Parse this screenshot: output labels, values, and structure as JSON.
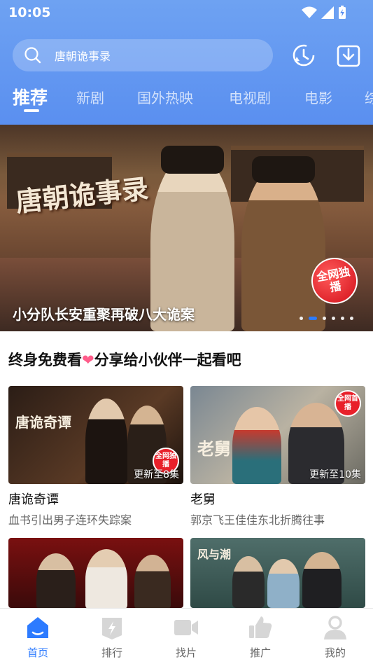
{
  "status": {
    "time": "10:05"
  },
  "search": {
    "text": "唐朝诡事录"
  },
  "tabs": [
    {
      "label": "推荐",
      "active": true
    },
    {
      "label": "新剧"
    },
    {
      "label": "国外热映"
    },
    {
      "label": "电视剧"
    },
    {
      "label": "电影"
    },
    {
      "label": "综"
    }
  ],
  "banner": {
    "logo_text": "唐朝诡事录",
    "badge": "全网独播",
    "caption": "小分队长安重聚再破八大诡案",
    "dot_count": 6,
    "active_dot": 1
  },
  "share": {
    "prefix": "终身免费看",
    "heart": "❤",
    "suffix": "分享给小伙伴一起看吧"
  },
  "cards": [
    {
      "title": "唐诡奇谭",
      "desc": "血书引出男子连环失踪案",
      "update": "更新至8集",
      "art_text": "唐诡奇谭",
      "stamp": "全网独播"
    },
    {
      "title": "老舅",
      "desc": "郭京飞王佳佳东北折腾往事",
      "update": "更新至10集",
      "art_text": "老舅",
      "stamp": "全网首播"
    },
    {
      "title": "",
      "desc": "",
      "update": "",
      "art_text": "",
      "stamp": ""
    },
    {
      "title": "",
      "desc": "",
      "update": "",
      "art_text": "风与潮",
      "stamp": ""
    }
  ],
  "nav": [
    {
      "label": "首页",
      "icon": "home-icon",
      "active": true
    },
    {
      "label": "排行",
      "icon": "ranking-icon"
    },
    {
      "label": "找片",
      "icon": "video-camera-icon"
    },
    {
      "label": "推广",
      "icon": "thumbs-up-icon"
    },
    {
      "label": "我的",
      "icon": "user-icon"
    }
  ],
  "colors": {
    "accent": "#2d7bff",
    "header_top": "#6ea2f2",
    "header_bottom": "#5a8ff0"
  }
}
